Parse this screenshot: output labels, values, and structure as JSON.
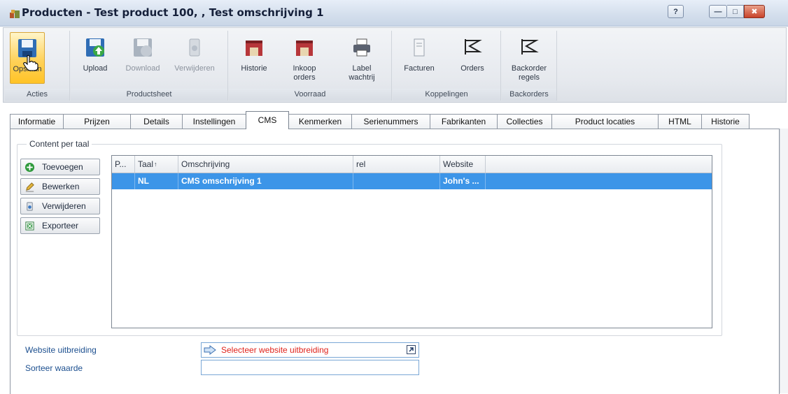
{
  "window": {
    "title": "Producten - Test product 100, , Test omschrijving 1",
    "help_label": "?"
  },
  "ribbon": {
    "groups": [
      {
        "label": "Acties"
      },
      {
        "label": "Productsheet"
      },
      {
        "label": "Voorraad"
      },
      {
        "label": "Koppelingen"
      },
      {
        "label": "Backorders"
      }
    ],
    "buttons": {
      "opslaan": "Opslaan",
      "upload": "Upload",
      "download": "Download",
      "verwijderen": "Verwijderen",
      "historie": "Historie",
      "inkoop_line1": "Inkoop",
      "inkoop_line2": "orders",
      "label_line1": "Label",
      "label_line2": "wachtrij",
      "facturen": "Facturen",
      "orders": "Orders",
      "backorder_line1": "Backorder",
      "backorder_line2": "regels"
    }
  },
  "tabs": [
    {
      "label": "Informatie"
    },
    {
      "label": "Prijzen"
    },
    {
      "label": "Details"
    },
    {
      "label": "Instellingen"
    },
    {
      "label": "CMS",
      "selected": true
    },
    {
      "label": "Kenmerken"
    },
    {
      "label": "Serienummers"
    },
    {
      "label": "Fabrikanten"
    },
    {
      "label": "Collecties"
    },
    {
      "label": "Product locaties"
    },
    {
      "label": "HTML"
    },
    {
      "label": "Historie"
    }
  ],
  "content": {
    "group_title": "Content per taal",
    "buttons": {
      "toevoegen": "Toevoegen",
      "bewerken": "Bewerken",
      "verwijderen": "Verwijderen",
      "exporteer": "Exporteer"
    },
    "grid": {
      "columns": [
        "P...",
        "Taal",
        "Omschrijving",
        "rel",
        "Website"
      ],
      "rows": [
        {
          "p": "",
          "taal": "NL",
          "omschrijving": "CMS omschrijving 1",
          "rel": "",
          "website": "John's ..."
        }
      ],
      "selection_color": "#3c95e8"
    }
  },
  "fields": {
    "website_uitbreiding_label": "Website uitbreiding",
    "website_uitbreiding_value": "Selecteer website uitbreiding",
    "sorteer_waarde_label": "Sorteer waarde",
    "sorteer_waarde_value": ""
  },
  "colors": {
    "accent": "#3c95e8",
    "ribbon_active": "#ffc326",
    "link_label": "#1c4f8f",
    "warning_text": "#e0221b"
  }
}
